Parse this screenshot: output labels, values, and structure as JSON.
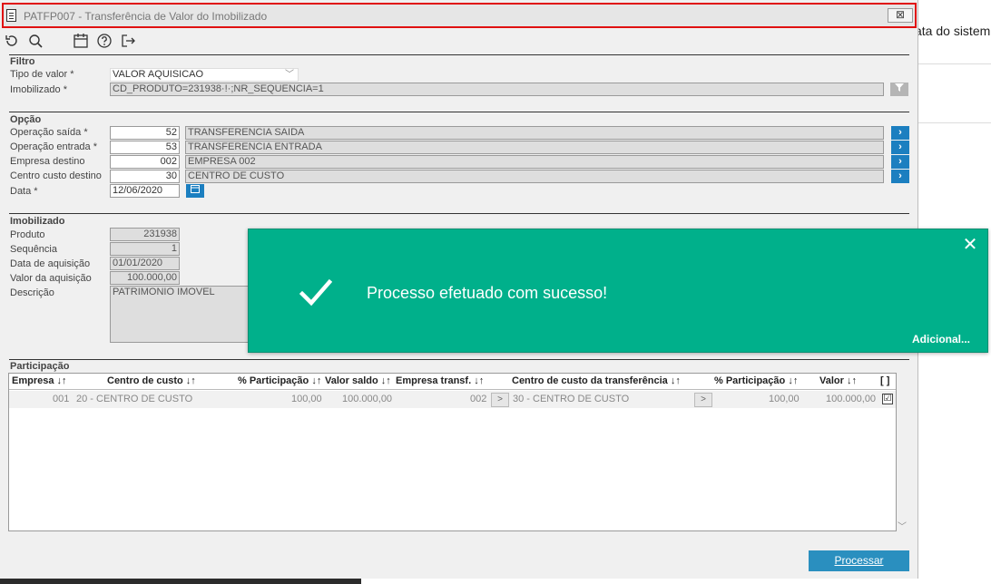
{
  "background": {
    "partial_text": "ata do sistem"
  },
  "window": {
    "title": "PATFP007 - Transferência de Valor do Imobilizado",
    "close_glyph": "⊠"
  },
  "toolbar": {
    "icons": [
      "refresh-icon",
      "search-icon",
      "calendar-icon",
      "help-icon",
      "exit-icon"
    ]
  },
  "filtro": {
    "title": "Filtro",
    "tipo_valor_label": "Tipo de valor *",
    "tipo_valor_value": "VALOR AQUISICAO",
    "imobilizado_label": "Imobilizado *",
    "imobilizado_value": "CD_PRODUTO=231938·!·;NR_SEQUENCIA=1"
  },
  "opcao": {
    "title": "Opção",
    "rows": [
      {
        "label": "Operação saída *",
        "code": "52",
        "desc": "TRANSFERENCIA SAIDA"
      },
      {
        "label": "Operação entrada *",
        "code": "53",
        "desc": "TRANSFERENCIA ENTRADA"
      },
      {
        "label": "Empresa destino",
        "code": "002",
        "desc": "EMPRESA 002"
      },
      {
        "label": "Centro custo destino",
        "code": "30",
        "desc": "CENTRO DE CUSTO"
      }
    ],
    "data_label": "Data *",
    "data_value": "12/06/2020"
  },
  "imobilizado": {
    "title": "Imobilizado",
    "produto_label": "Produto",
    "produto_value": "231938",
    "sequencia_label": "Sequência",
    "sequencia_value": "1",
    "data_aquisicao_label": "Data de aquisição",
    "data_aquisicao_value": "01/01/2020",
    "valor_aquisicao_label": "Valor da aquisição",
    "valor_aquisicao_value": "100.000,00",
    "descricao_label": "Descrição",
    "descricao_value": "PATRIMONIO IMOVEL"
  },
  "participacao": {
    "title": "Participação",
    "columns": [
      "Empresa ↓↑",
      "Centro de custo ↓↑",
      "% Participação ↓↑",
      "Valor saldo ↓↑",
      "Empresa transf. ↓↑",
      "Centro de custo da transferência ↓↑",
      "% Participação ↓↑",
      "Valor ↓↑",
      "[ ]"
    ],
    "row": {
      "empresa": "001",
      "centro_custo": "20 - CENTRO DE CUSTO",
      "participacao": "100,00",
      "valor_saldo": "100.000,00",
      "empresa_transf": "002",
      "btn1": ">",
      "centro_custo_transf": "30 - CENTRO DE CUSTO",
      "btn2": ">",
      "participacao_transf": "100,00",
      "valor": "100.000,00",
      "checked": "☑"
    }
  },
  "actions": {
    "process_label": "Processar"
  },
  "toast": {
    "message": "Processo efetuado com sucesso!",
    "more_label": "Adicional...",
    "close_glyph": "✕"
  },
  "colors": {
    "toast_bg": "#00b08b",
    "accent_blue": "#1c7fc0",
    "title_highlight": "#e01010"
  }
}
